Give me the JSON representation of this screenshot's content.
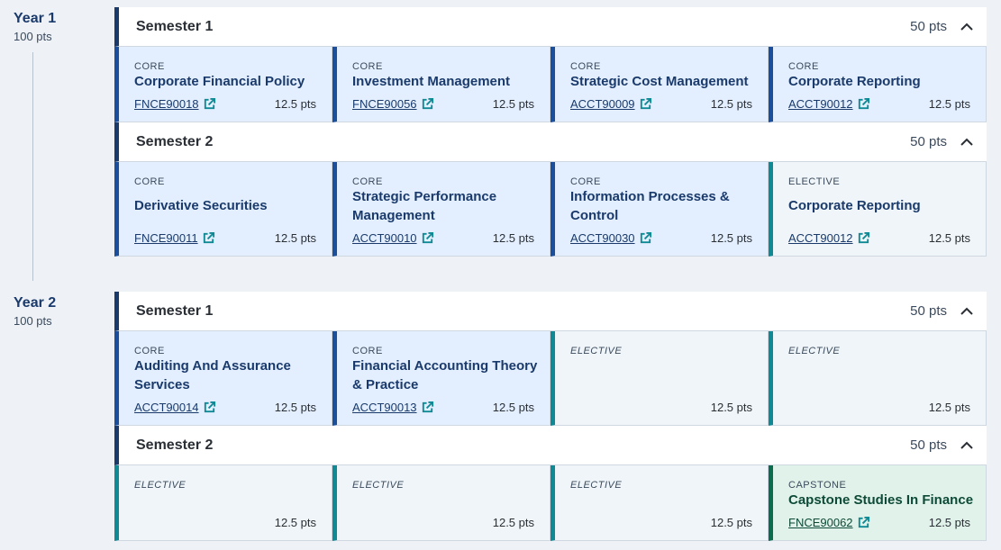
{
  "years": [
    {
      "title": "Year 1",
      "pts": "100 pts",
      "semesters": [
        {
          "title": "Semester 1",
          "pts": "50 pts",
          "subjects": [
            {
              "kind": "CORE",
              "name": "Corporate Financial Policy",
              "code": "FNCE90018",
              "pts": "12.5 pts",
              "variant": "core"
            },
            {
              "kind": "CORE",
              "name": "Investment Management",
              "code": "FNCE90056",
              "pts": "12.5 pts",
              "variant": "core"
            },
            {
              "kind": "CORE",
              "name": "Strategic Cost Management",
              "code": "ACCT90009",
              "pts": "12.5 pts",
              "variant": "core"
            },
            {
              "kind": "CORE",
              "name": "Corporate Reporting",
              "code": "ACCT90012",
              "pts": "12.5 pts",
              "variant": "core"
            }
          ]
        },
        {
          "title": "Semester 2",
          "pts": "50 pts",
          "subjects": [
            {
              "kind": "CORE",
              "name": "Derivative Securities",
              "code": "FNCE90011",
              "pts": "12.5 pts",
              "variant": "core"
            },
            {
              "kind": "CORE",
              "name": "Strategic Performance Management",
              "code": "ACCT90010",
              "pts": "12.5 pts",
              "variant": "core"
            },
            {
              "kind": "CORE",
              "name": "Information Processes & Control",
              "code": "ACCT90030",
              "pts": "12.5 pts",
              "variant": "core"
            },
            {
              "kind": "ELECTIVE",
              "name": "Corporate Reporting",
              "code": "ACCT90012",
              "pts": "12.5 pts",
              "variant": "elective-filled"
            }
          ]
        }
      ]
    },
    {
      "title": "Year 2",
      "pts": "100 pts",
      "semesters": [
        {
          "title": "Semester 1",
          "pts": "50 pts",
          "subjects": [
            {
              "kind": "CORE",
              "name": "Auditing And Assurance Services",
              "code": "ACCT90014",
              "pts": "12.5 pts",
              "variant": "core"
            },
            {
              "kind": "CORE",
              "name": "Financial Accounting Theory & Practice",
              "code": "ACCT90013",
              "pts": "12.5 pts",
              "variant": "core"
            },
            {
              "kind": "ELECTIVE",
              "name": "",
              "code": "",
              "pts": "12.5 pts",
              "variant": "elective"
            },
            {
              "kind": "ELECTIVE",
              "name": "",
              "code": "",
              "pts": "12.5 pts",
              "variant": "elective"
            }
          ]
        },
        {
          "title": "Semester 2",
          "pts": "50 pts",
          "subjects": [
            {
              "kind": "ELECTIVE",
              "name": "",
              "code": "",
              "pts": "12.5 pts",
              "variant": "elective"
            },
            {
              "kind": "ELECTIVE",
              "name": "",
              "code": "",
              "pts": "12.5 pts",
              "variant": "elective"
            },
            {
              "kind": "ELECTIVE",
              "name": "",
              "code": "",
              "pts": "12.5 pts",
              "variant": "elective"
            },
            {
              "kind": "CAPSTONE",
              "name": "Capstone Studies In Finance",
              "code": "FNCE90062",
              "pts": "12.5 pts",
              "variant": "capstone"
            }
          ]
        }
      ]
    }
  ],
  "icons": {
    "collapse": "chevron-up-icon",
    "external": "external-link-icon"
  },
  "colors": {
    "core_accent": "#1b4f9c",
    "elective_accent": "#0f8a94",
    "capstone_accent": "#0d6b4e",
    "header_accent": "#1a3a6b"
  }
}
